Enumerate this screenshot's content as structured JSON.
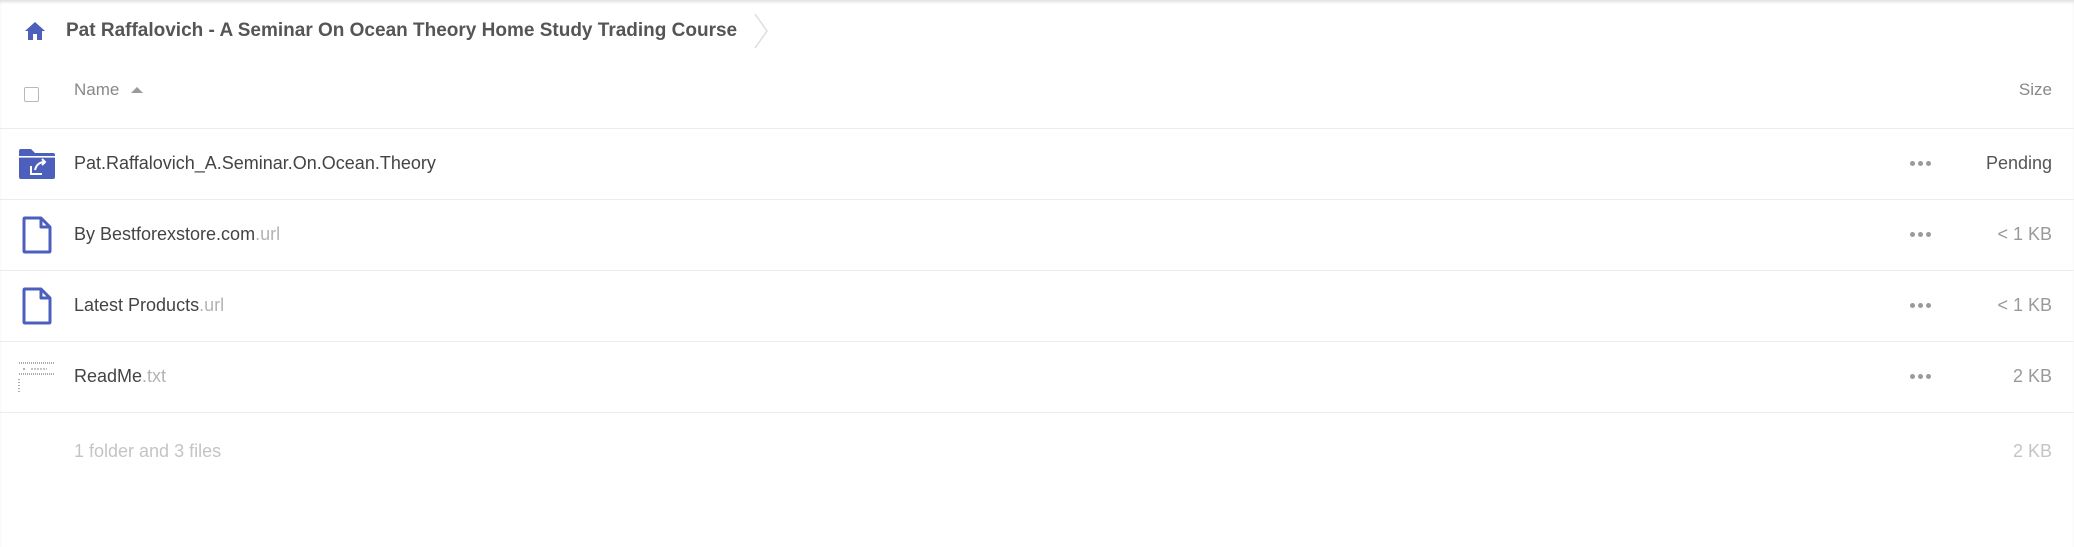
{
  "breadcrumb": {
    "home_icon": "home-icon",
    "current": "Pat Raffalovich - A Seminar On Ocean Theory Home Study Trading Course"
  },
  "table": {
    "columns": {
      "name": "Name",
      "size": "Size"
    },
    "sort": "name-ascending",
    "rows": [
      {
        "icon": "shared-folder-icon",
        "name": "Pat.Raffalovich_A.Seminar.On.Ocean.Theory",
        "ext": "",
        "size": "Pending"
      },
      {
        "icon": "file-icon",
        "name": "By Bestforexstore.com",
        "ext": ".url",
        "size": "< 1 KB"
      },
      {
        "icon": "file-icon",
        "name": "Latest Products",
        "ext": ".url",
        "size": "< 1 KB"
      },
      {
        "icon": "text-file-thumbnail-icon",
        "name": "ReadMe",
        "ext": ".txt",
        "size": "2 KB"
      }
    ],
    "summary": {
      "text": "1 folder and 3 files",
      "size": "2 KB"
    }
  },
  "colors": {
    "accent": "#4c5fbd",
    "text": "#444444",
    "muted": "#999999",
    "divider": "#ececec"
  }
}
